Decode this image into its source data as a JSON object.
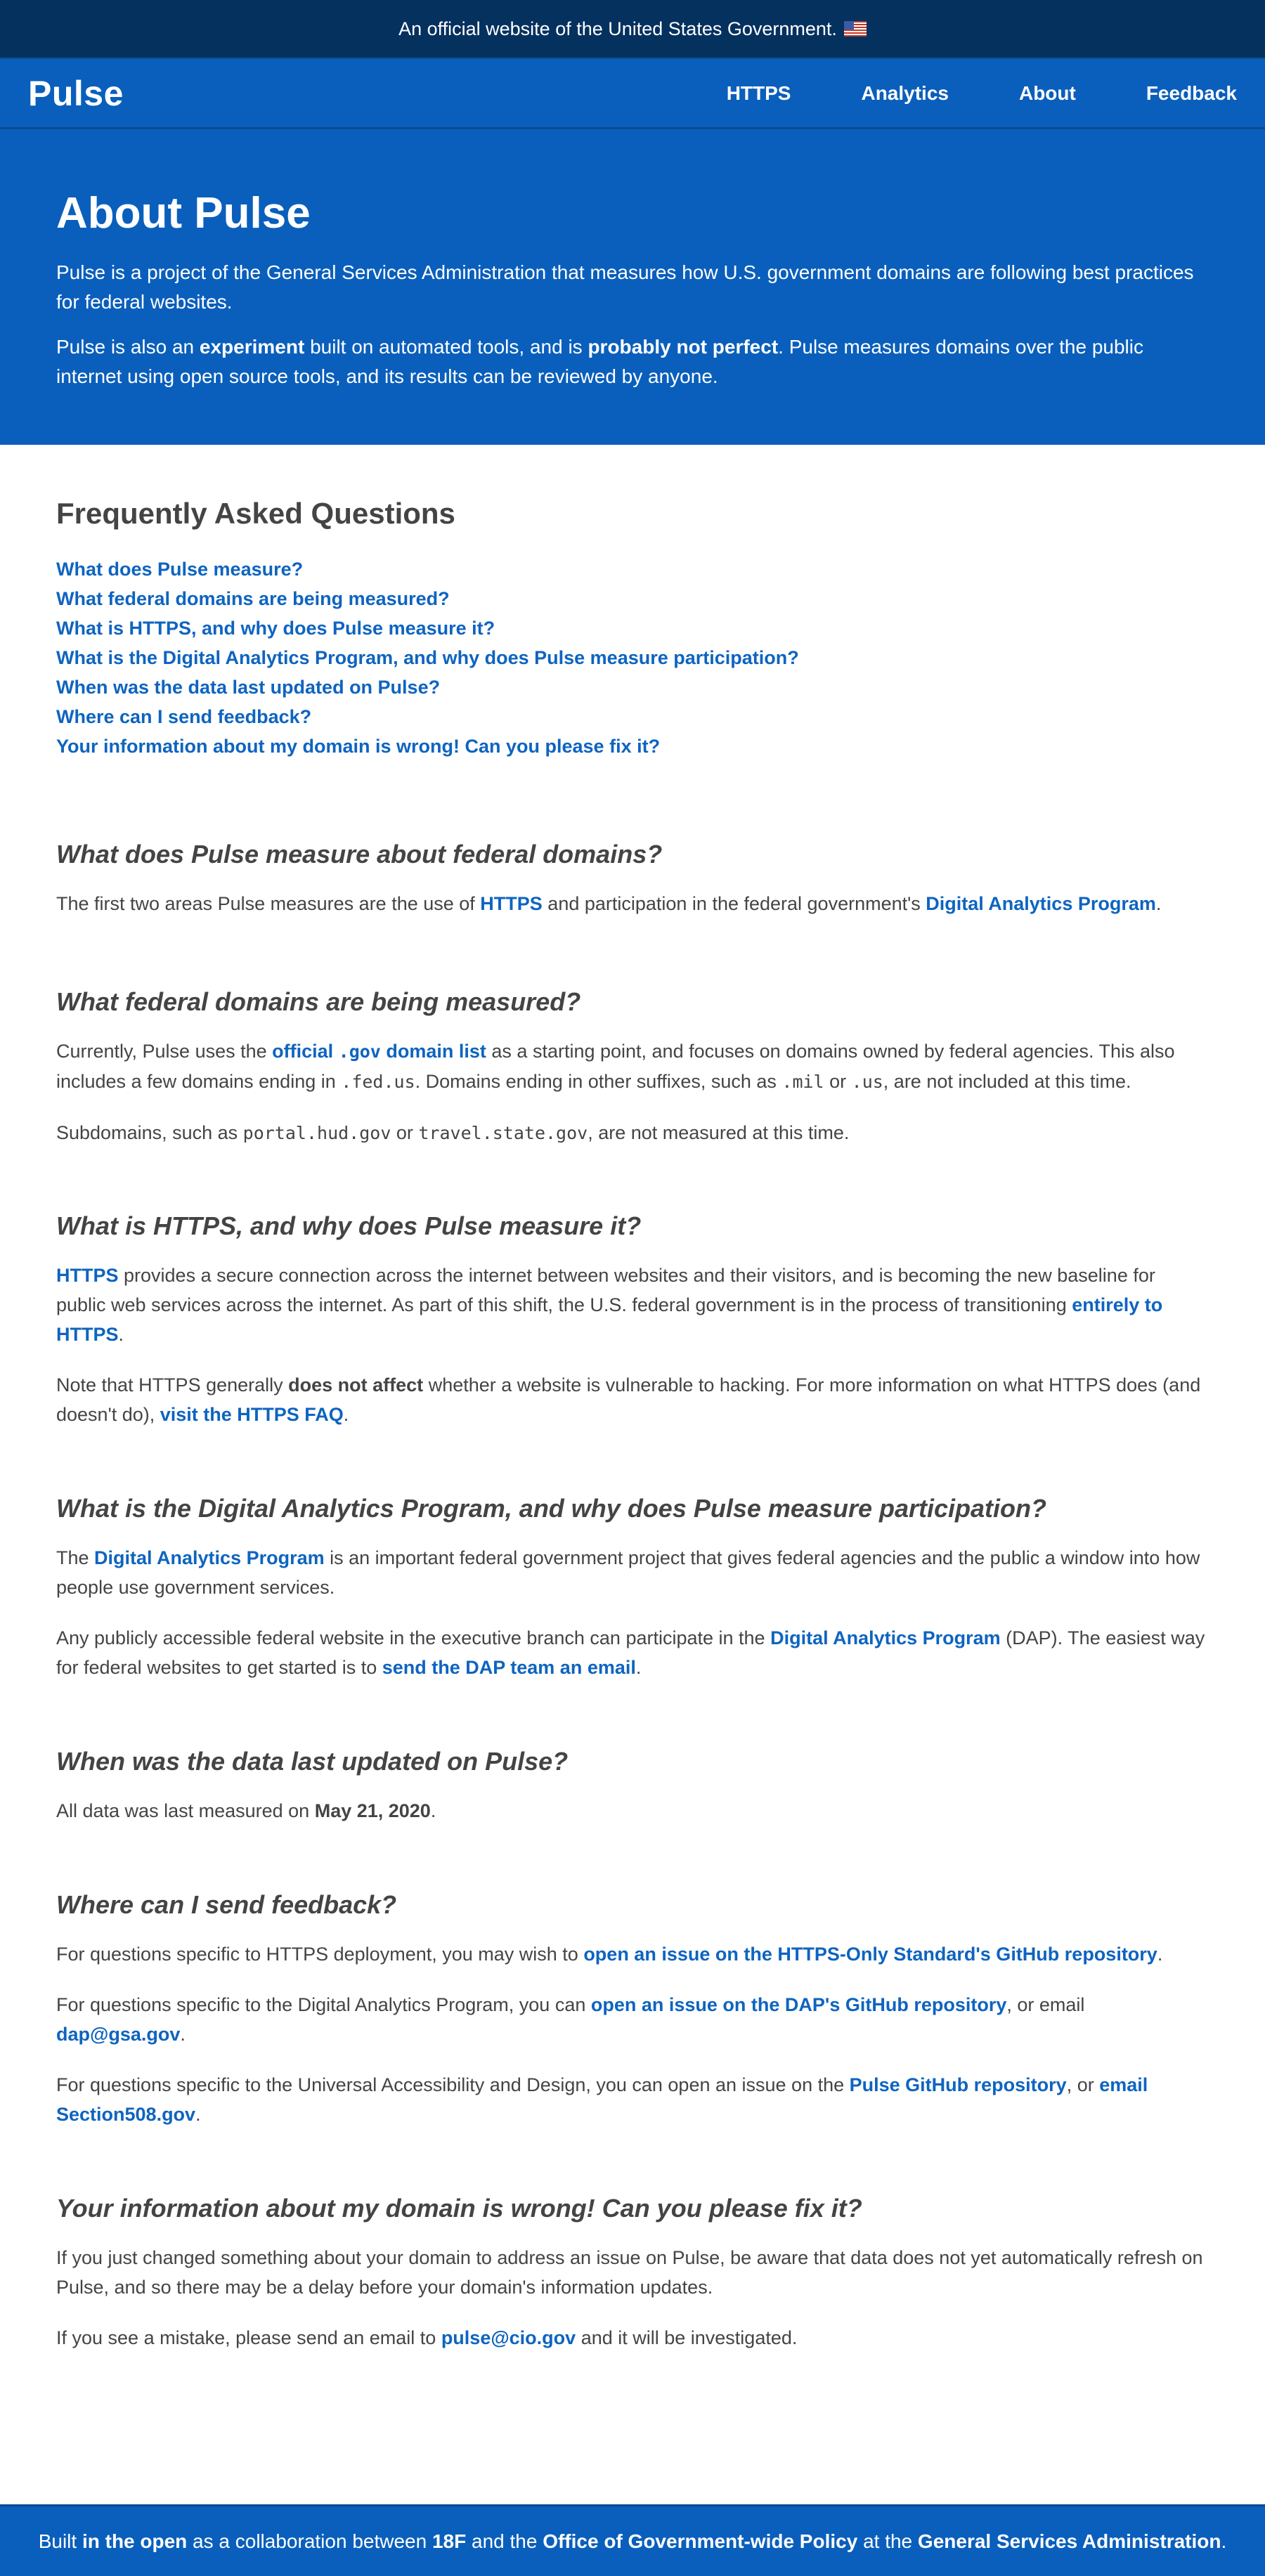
{
  "gov_banner": {
    "text": "An official website of the United States Government."
  },
  "nav": {
    "brand": "Pulse",
    "links": [
      "HTTPS",
      "Analytics",
      "About",
      "Feedback"
    ]
  },
  "hero": {
    "title": "About Pulse",
    "p1": "Pulse is a project of the General Services Administration that measures how U.S. government domains are following best practices for federal websites.",
    "p2": {
      "a": "Pulse is also an ",
      "b": "experiment",
      "c": " built on automated tools, and is ",
      "d": "probably not perfect",
      "e": ". Pulse measures domains over the public internet using open source tools, and its results can be reviewed by anyone."
    }
  },
  "faq": {
    "title": "Frequently Asked Questions",
    "items": [
      "What does Pulse measure?",
      "What federal domains are being measured?",
      "What is HTTPS, and why does Pulse measure it?",
      "What is the Digital Analytics Program, and why does Pulse measure participation?",
      "When was the data last updated on Pulse?",
      "Where can I send feedback?",
      "Your information about my domain is wrong! Can you please fix it?"
    ]
  },
  "s1": {
    "title": "What does Pulse measure about federal domains?",
    "t1": "The first two areas Pulse measures are the use of ",
    "l1": "HTTPS",
    "t2": " and participation in the federal government's ",
    "l2": "Digital Analytics Program",
    "t3": "."
  },
  "s2": {
    "title": "What federal domains are being measured?",
    "t1": "Currently, Pulse uses the ",
    "l1a": "official ",
    "l1code": ".gov",
    "l1b": " domain list",
    "t2": " as a starting point, and focuses on domains owned by federal agencies. This also includes a few domains ending in ",
    "c1": ".fed.us",
    "t3": ". Domains ending in other suffixes, such as ",
    "c2": ".mil",
    "t4": " or ",
    "c3": ".us",
    "t5": ", are not included at this time.",
    "p2a": "Subdomains, such as ",
    "p2c1": "portal.hud.gov",
    "p2b": " or ",
    "p2c2": "travel.state.gov",
    "p2d": ", are not measured at this time."
  },
  "s3": {
    "title": "What is HTTPS, and why does Pulse measure it?",
    "l1": "HTTPS",
    "t1": " provides a secure connection across the internet between websites and their visitors, and is becoming the new baseline for public web services across the internet. As part of this shift, the U.S. federal government is in the process of transitioning ",
    "l2": "entirely to HTTPS",
    "t2": ".",
    "p2a": "Note that HTTPS generally ",
    "p2b": "does not affect",
    "p2c": " whether a website is vulnerable to hacking. For more information on what HTTPS does (and doesn't do), ",
    "p2l": "visit the HTTPS FAQ",
    "p2d": "."
  },
  "s4": {
    "title": "What is the Digital Analytics Program, and why does Pulse measure participation?",
    "p1a": "The ",
    "p1l": "Digital Analytics Program",
    "p1b": " is an important federal government project that gives federal agencies and the public a window into how people use government services.",
    "p2a": "Any publicly accessible federal website in the executive branch can participate in the ",
    "p2l1": "Digital Analytics Program",
    "p2b": " (DAP). The easiest way for federal websites to get started is to ",
    "p2l2": "send the DAP team an email",
    "p2c": "."
  },
  "s5": {
    "title": "When was the data last updated on Pulse?",
    "t1": "All data was last measured on ",
    "date": "May 21, 2020",
    "t2": "."
  },
  "s6": {
    "title": "Where can I send feedback?",
    "p1a": "For questions specific to HTTPS deployment, you may wish to ",
    "p1l": "open an issue on the HTTPS-Only Standard's GitHub repository",
    "p1b": ".",
    "p2a": "For questions specific to the Digital Analytics Program, you can ",
    "p2l1": "open an issue on the DAP's GitHub repository",
    "p2b": ", or email ",
    "p2l2": "dap@gsa.gov",
    "p2c": ".",
    "p3a": "For questions specific to the Universal Accessibility and Design, you can open an issue on the ",
    "p3l1": "Pulse GitHub repository",
    "p3b": ", or ",
    "p3l2": "email Section508.gov",
    "p3c": "."
  },
  "s7": {
    "title": "Your information about my domain is wrong! Can you please fix it?",
    "p1": "If you just changed something about your domain to address an issue on Pulse, be aware that data does not yet automatically refresh on Pulse, and so there may be a delay before your domain's information updates.",
    "p2a": "If you see a mistake, please send an email to ",
    "p2l": "pulse@cio.gov",
    "p2b": " and it will be investigated."
  },
  "footer": {
    "a": "Built ",
    "b": "in the open",
    "c": " as a collaboration between ",
    "d": "18F",
    "e": " and the ",
    "f": "Office of Government-wide Policy",
    "g": " at the ",
    "h": "General Services Administration",
    "i": "."
  },
  "colors": {
    "gov_banner_bg": "#05315f",
    "primary_blue": "#0a5fbc",
    "link_blue": "#0e64c0",
    "body_text": "#444444"
  }
}
